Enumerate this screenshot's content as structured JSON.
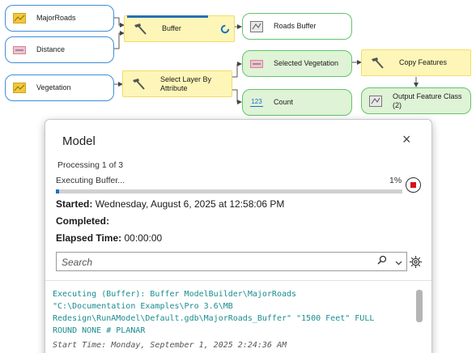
{
  "diagram": {
    "inputs": {
      "major_roads": "MajorRoads",
      "distance": "Distance",
      "vegetation": "Vegetation"
    },
    "tools": {
      "buffer": "Buffer",
      "select_layer": "Select Layer By Attribute",
      "copy_features": "Copy Features"
    },
    "outputs": {
      "roads_buffer": "Roads Buffer",
      "selected_vegetation": "Selected Vegetation",
      "count": "Count",
      "count_icon_text": "123",
      "output_feature_class": "Output Feature Class (2)"
    },
    "colors": {
      "input_border": "#3e8ed8",
      "tool_fill": "#fdf6b8",
      "output_border": "#62c46a"
    }
  },
  "dialog": {
    "title": "Model",
    "close_symbol": "×",
    "processing": "Processing 1 of 3",
    "executing": "Executing Buffer...",
    "progress_percent_text": "1%",
    "progress_fraction": 0.01,
    "started_label": "Started:",
    "started_value": "Wednesday, August 6, 2025 at 12:58:06 PM",
    "completed_label": "Completed:",
    "completed_value": "",
    "elapsed_label": "Elapsed Time:",
    "elapsed_value": "00:00:00",
    "search_placeholder": "Search",
    "log_command": "Executing (Buffer): Buffer ModelBuilder\\MajorRoads\n\"C:\\Documentation Examples\\Pro 3.6\\MB\nRedesign\\RunAModel\\Default.gdb\\MajorRoads_Buffer\" \"1500 Feet\" FULL\nROUND NONE # PLANAR",
    "log_start_time": "Start Time: Monday, September 1, 2025 2:24:36 AM",
    "colors": {
      "progress": "#1d6fc4",
      "stop": "#d8111b",
      "log_text": "#1a8c8f"
    }
  }
}
